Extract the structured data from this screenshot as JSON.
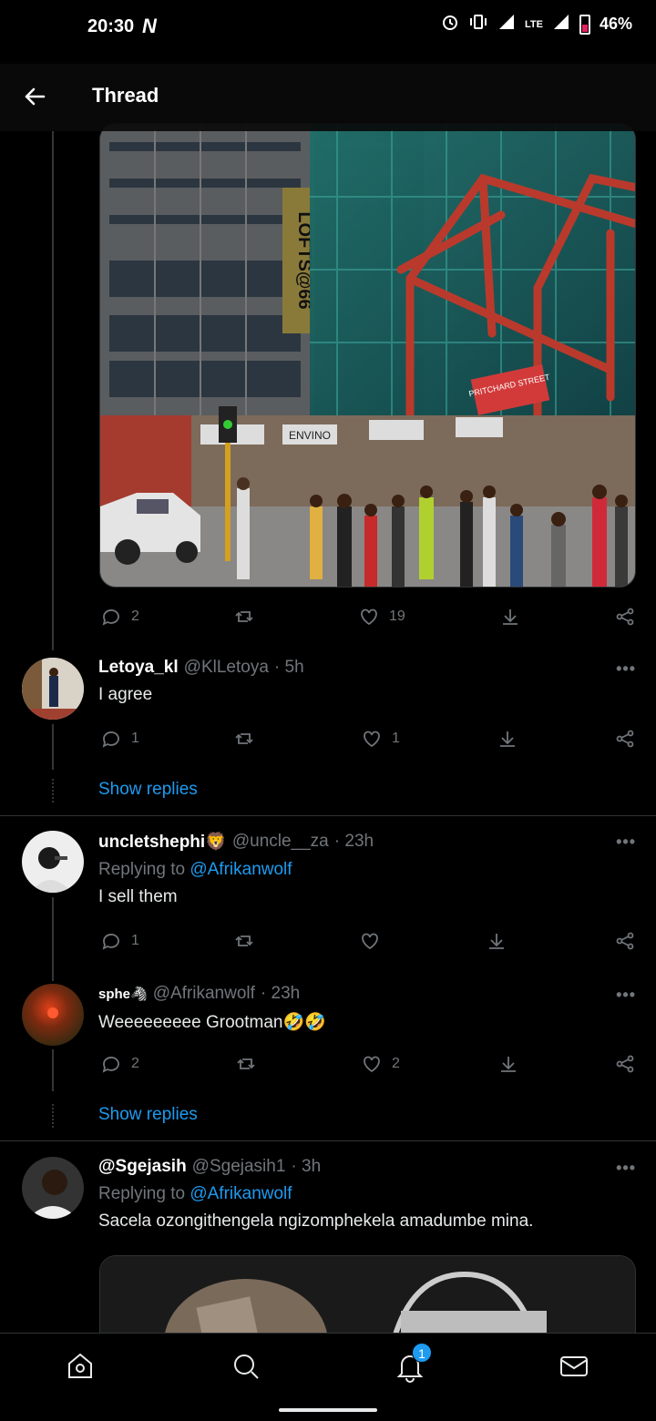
{
  "status_bar": {
    "time": "20:30",
    "carrier_glyph": "N",
    "network": "LTE",
    "battery": "46%"
  },
  "header": {
    "title": "Thread"
  },
  "main_tweet_actions": {
    "replies": "2",
    "retweets": "",
    "likes": "19"
  },
  "replies": [
    {
      "name": "Letoya_kl",
      "handle": "@KlLetoya",
      "time": "· 5h",
      "replying_to": "",
      "text": "I agree",
      "reply_count": "1",
      "retweet_count": "",
      "like_count": "1",
      "show_replies": "Show replies"
    },
    {
      "name": "uncletshephi🦁",
      "handle": "@uncle__za",
      "time": "· 23h",
      "replying_prefix": "Replying to",
      "replying_to": "@Afrikanwolf",
      "text": "I sell them",
      "reply_count": "1",
      "retweet_count": "",
      "like_count": ""
    },
    {
      "name": "sphe🦓",
      "handle": "@Afrikanwolf",
      "time": "· 23h",
      "replying_to": "",
      "text": "Weeeeeeeee Grootman🤣🤣",
      "reply_count": "2",
      "retweet_count": "",
      "like_count": "2",
      "show_replies": "Show replies"
    },
    {
      "name": "@Sgejasih",
      "handle": "@Sgejasih1",
      "time": "· 3h",
      "replying_prefix": "Replying to",
      "replying_to": "@Afrikanwolf",
      "text": "Sacela ozongithengela ngizomphekela amadumbe mina."
    }
  ],
  "bottom_nav": {
    "notifications_badge": "1"
  },
  "image_signs": {
    "lofts": "LOFTS@66",
    "envino": "ENVINO",
    "pritchard": "PRITCHARD STREET"
  },
  "colors": {
    "background": "#000000",
    "accent": "#1d9bf0",
    "secondary_text": "#71767b"
  }
}
